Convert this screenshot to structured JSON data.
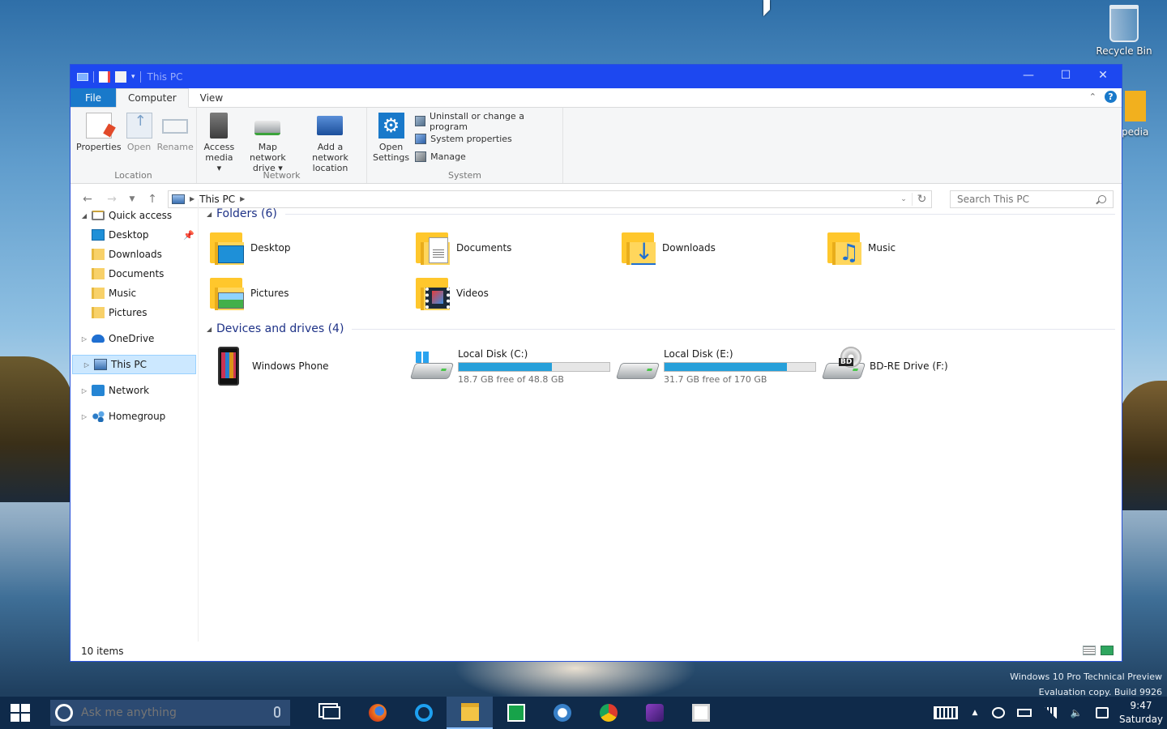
{
  "desktop": {
    "recycle_bin_label": "Recycle Bin",
    "partial_icon_label": "pedia",
    "watermark_line1": "Windows 10 Pro Technical Preview",
    "watermark_line2": "Evaluation copy. Build 9926"
  },
  "window": {
    "title": "This PC",
    "controls": {
      "minimize": "—",
      "maximize": "☐",
      "close": "✕"
    }
  },
  "ribbon": {
    "tabs": [
      {
        "label": "File"
      },
      {
        "label": "Computer"
      },
      {
        "label": "View"
      }
    ],
    "groups": {
      "location": {
        "label": "Location",
        "buttons": [
          {
            "label": "Properties"
          },
          {
            "label": "Open"
          },
          {
            "label": "Rename"
          }
        ]
      },
      "network": {
        "label": "Network",
        "buttons": [
          {
            "line1": "Access",
            "line2": "media ▾"
          },
          {
            "line1": "Map network",
            "line2": "drive ▾"
          },
          {
            "line1": "Add a network",
            "line2": "location"
          }
        ]
      },
      "system": {
        "label": "System",
        "open_settings": {
          "line1": "Open",
          "line2": "Settings"
        },
        "items": [
          {
            "label": "Uninstall or change a program"
          },
          {
            "label": "System properties"
          },
          {
            "label": "Manage"
          }
        ]
      }
    }
  },
  "addressbar": {
    "path": "This PC",
    "search_placeholder": "Search This PC"
  },
  "navpane": {
    "quick_access": "Quick access",
    "quick_items": [
      {
        "label": "Desktop"
      },
      {
        "label": "Downloads"
      },
      {
        "label": "Documents"
      },
      {
        "label": "Music"
      },
      {
        "label": "Pictures"
      }
    ],
    "onedrive": "OneDrive",
    "this_pc": "This PC",
    "network": "Network",
    "homegroup": "Homegroup"
  },
  "folders": {
    "header": "Folders (6)",
    "items": [
      {
        "name": "Desktop"
      },
      {
        "name": "Documents"
      },
      {
        "name": "Downloads"
      },
      {
        "name": "Music"
      },
      {
        "name": "Pictures"
      },
      {
        "name": "Videos"
      }
    ]
  },
  "drives": {
    "header": "Devices and drives (4)",
    "phone": {
      "name": "Windows Phone"
    },
    "c": {
      "name": "Local Disk (C:)",
      "free": "18.7 GB free of 48.8 GB",
      "used_fraction": 0.617
    },
    "e": {
      "name": "Local Disk (E:)",
      "free": "31.7 GB free of 170 GB",
      "used_fraction": 0.814
    },
    "f": {
      "name": "BD-RE Drive (F:)",
      "badge": "BD"
    }
  },
  "status": {
    "items_count": "10 items"
  },
  "taskbar": {
    "search_placeholder": "Ask me anything",
    "clock_time": "9:47",
    "clock_day": "Saturday"
  }
}
